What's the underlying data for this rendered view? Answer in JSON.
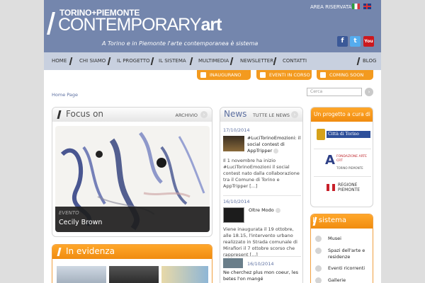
{
  "header": {
    "logo_top": "TORINO+PIEMONTE",
    "logo_main": "CONTEMPORARY",
    "logo_suffix": "art",
    "tagline": "A Torino e in Piemonte l'arte contemporanea è sistema",
    "area_riservata": "AREA RISERVATA",
    "colors": {
      "header_bg": "#7486ad",
      "nav_bg": "#c8d0df",
      "accent": "#f39a1f"
    }
  },
  "social": {
    "facebook_icon": "f",
    "twitter_icon": "t",
    "youtube_icon": "You"
  },
  "nav": {
    "items": [
      "HOME",
      "CHI SIAMO",
      "IL PROGETTO",
      "IL SISTEMA",
      "MULTIMEDIA",
      "NEWSLETTER",
      "CONTATTI",
      "BLOG"
    ]
  },
  "buttons": {
    "inaugurano": "INAUGURANO OGGI",
    "in_corso": "EVENTI IN CORSO",
    "coming_soon": "COMING SOON"
  },
  "breadcrumb": "Home Page",
  "search": {
    "placeholder": "Cerca"
  },
  "focus": {
    "title": "Focus on",
    "archive": "ARCHIVIO",
    "kicker": "EVENTO",
    "caption": "Cecily Brown"
  },
  "evidenza": {
    "title": "In evidenza"
  },
  "news": {
    "title": "News",
    "all": "TUTTE LE NEWS",
    "items": [
      {
        "date": "17/10/2014",
        "title": "#LuciTorinoEmozioni: il social contest di AppTripper",
        "text": "Il 1 novembre ha inizio #LuciTorinoEmozioni il social contest nato dalla collaborazione tra il Comune di Torino e AppTripper [...]"
      },
      {
        "date": "16/10/2014",
        "title": "Oltre Modo",
        "text": "Viene inaugurata il 19 ottobre, alle 18.15, l'intervento urbano realizzato in Strada comunale di Mirafiori il 7 ottobre scorso che rappresent [...]"
      },
      {
        "date": "16/10/2014",
        "title": "Ne cherchez plus mon coeur, les betes l'on mangé",
        "text": ""
      }
    ]
  },
  "partners": {
    "title": "Un progetto a cura di",
    "items": [
      "Città di Torino",
      "FONDAZIONE ARTE CRT",
      "REGIONE PIEMONTE"
    ],
    "crt_sub": "TORINO PIEMONTE"
  },
  "sistema": {
    "title": "Il sistema",
    "items": [
      "Musei",
      "Spazi dell'arte e residenze",
      "Eventi ricorrenti",
      "Gallerie"
    ]
  }
}
